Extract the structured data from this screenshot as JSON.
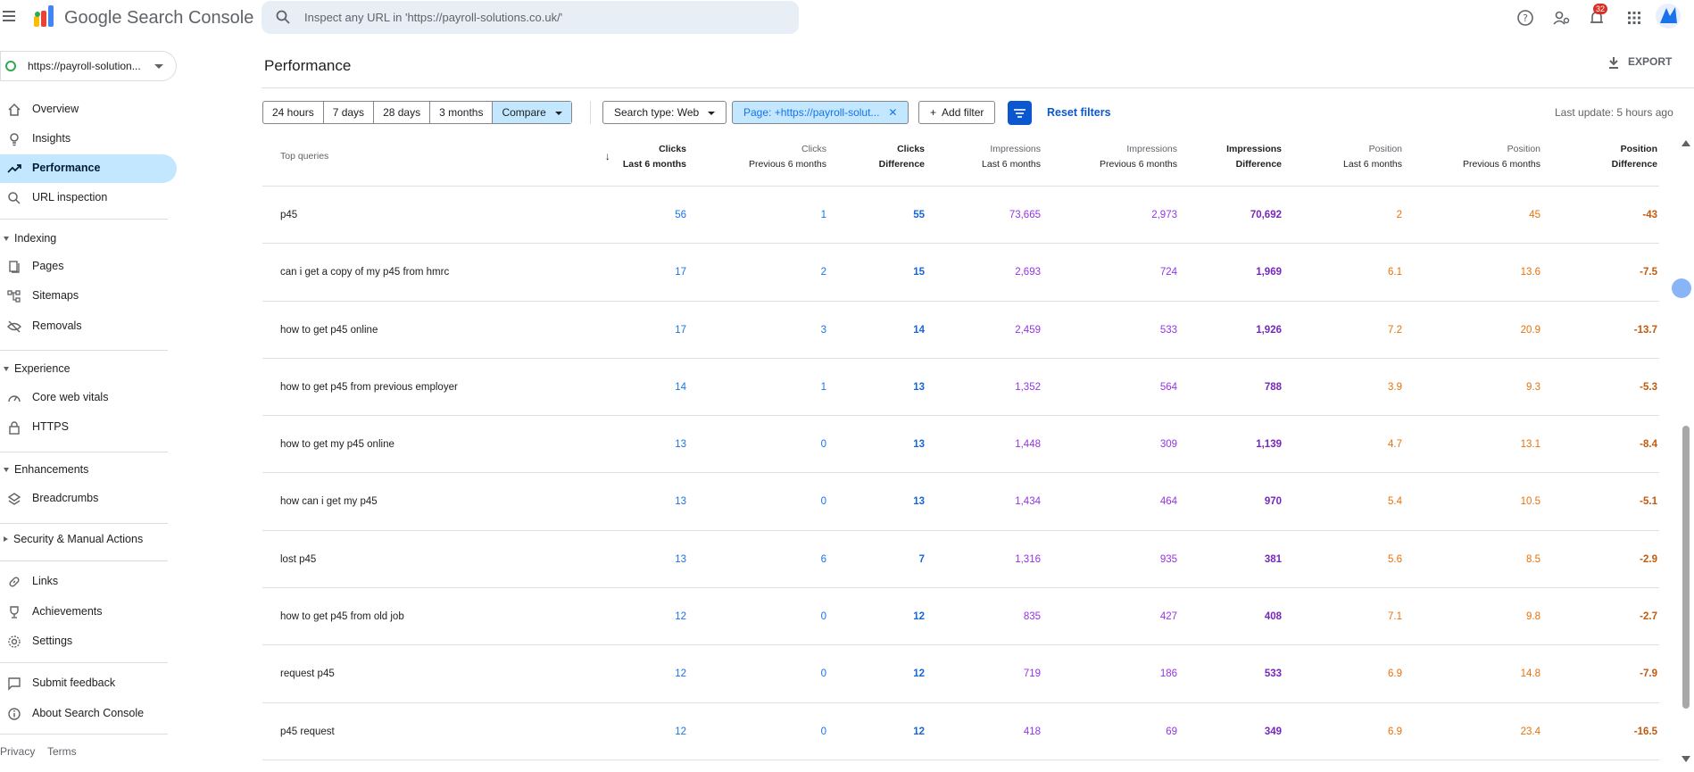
{
  "app": {
    "brand": "Google Search Console",
    "search_placeholder": "Inspect any URL in 'https://payroll-solutions.co.uk/'",
    "notification_count": "32"
  },
  "sidebar": {
    "property": "https://payroll-solution...",
    "items_top": [
      {
        "label": "Overview",
        "icon": "home-icon"
      },
      {
        "label": "Insights",
        "icon": "lightbulb-icon"
      },
      {
        "label": "Performance",
        "icon": "trending-up-icon",
        "active": true
      },
      {
        "label": "URL inspection",
        "icon": "search-icon"
      }
    ],
    "indexing": {
      "title": "Indexing",
      "items": [
        {
          "label": "Pages",
          "icon": "pages-icon"
        },
        {
          "label": "Sitemaps",
          "icon": "sitemap-icon"
        },
        {
          "label": "Removals",
          "icon": "eye-off-icon"
        }
      ]
    },
    "experience": {
      "title": "Experience",
      "items": [
        {
          "label": "Core web vitals",
          "icon": "gauge-icon"
        },
        {
          "label": "HTTPS",
          "icon": "lock-icon"
        }
      ]
    },
    "enhancements": {
      "title": "Enhancements",
      "items": [
        {
          "label": "Breadcrumbs",
          "icon": "layers-icon"
        }
      ]
    },
    "security": {
      "title": "Security & Manual Actions"
    },
    "items_bottom": [
      {
        "label": "Links",
        "icon": "link-icon"
      },
      {
        "label": "Achievements",
        "icon": "trophy-icon"
      },
      {
        "label": "Settings",
        "icon": "gear-icon"
      }
    ],
    "items_feedback": [
      {
        "label": "Submit feedback",
        "icon": "feedback-icon"
      },
      {
        "label": "About Search Console",
        "icon": "info-icon"
      }
    ],
    "privacy": "Privacy",
    "terms": "Terms"
  },
  "main": {
    "title": "Performance",
    "export": "EXPORT",
    "date_ranges": [
      "24 hours",
      "7 days",
      "28 days",
      "3 months"
    ],
    "compare": "Compare",
    "search_type": "Search type: Web",
    "page_filter": "Page: +https://payroll-solut...",
    "add_filter": "Add filter",
    "reset_filters": "Reset filters",
    "last_update": "Last update: 5 hours ago"
  },
  "table": {
    "query_header": "Top queries",
    "columns": [
      {
        "top": "Clicks",
        "sub": "Last 6 months"
      },
      {
        "top": "Clicks",
        "sub": "Previous 6 months"
      },
      {
        "top": "Clicks",
        "sub": "Difference"
      },
      {
        "top": "Impressions",
        "sub": "Last 6 months"
      },
      {
        "top": "Impressions",
        "sub": "Previous 6 months"
      },
      {
        "top": "Impressions",
        "sub": "Difference"
      },
      {
        "top": "Position",
        "sub": "Last 6 months"
      },
      {
        "top": "Position",
        "sub": "Previous 6 months"
      },
      {
        "top": "Position",
        "sub": "Difference"
      }
    ],
    "rows": [
      [
        "p45",
        "56",
        "1",
        "55",
        "73,665",
        "2,973",
        "70,692",
        "2",
        "45",
        "-43"
      ],
      [
        "can i get a copy of my p45 from hmrc",
        "17",
        "2",
        "15",
        "2,693",
        "724",
        "1,969",
        "6.1",
        "13.6",
        "-7.5"
      ],
      [
        "how to get p45 online",
        "17",
        "3",
        "14",
        "2,459",
        "533",
        "1,926",
        "7.2",
        "20.9",
        "-13.7"
      ],
      [
        "how to get p45 from previous employer",
        "14",
        "1",
        "13",
        "1,352",
        "564",
        "788",
        "3.9",
        "9.3",
        "-5.3"
      ],
      [
        "how to get my p45 online",
        "13",
        "0",
        "13",
        "1,448",
        "309",
        "1,139",
        "4.7",
        "13.1",
        "-8.4"
      ],
      [
        "how can i get my p45",
        "13",
        "0",
        "13",
        "1,434",
        "464",
        "970",
        "5.4",
        "10.5",
        "-5.1"
      ],
      [
        "lost p45",
        "13",
        "6",
        "7",
        "1,316",
        "935",
        "381",
        "5.6",
        "8.5",
        "-2.9"
      ],
      [
        "how to get p45 from old job",
        "12",
        "0",
        "12",
        "835",
        "427",
        "408",
        "7.1",
        "9.8",
        "-2.7"
      ],
      [
        "request p45",
        "12",
        "0",
        "12",
        "719",
        "186",
        "533",
        "6.9",
        "14.8",
        "-7.9"
      ],
      [
        "p45 request",
        "12",
        "0",
        "12",
        "418",
        "69",
        "349",
        "6.9",
        "23.4",
        "-16.5"
      ]
    ]
  },
  "colors": {
    "clicks": "#1a73e8",
    "impressions": "#9334e6",
    "position": "#e8710a",
    "active_nav": "#c2e7ff"
  }
}
